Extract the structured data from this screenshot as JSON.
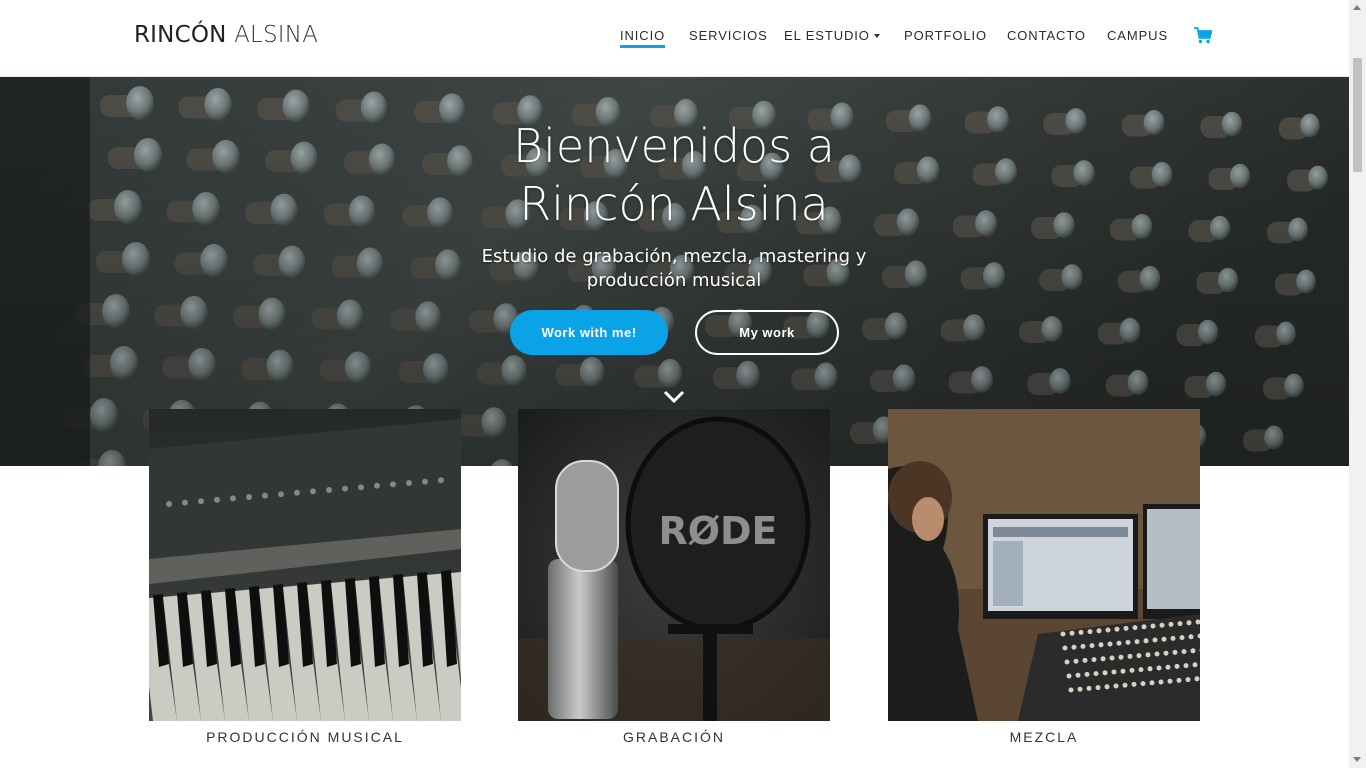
{
  "header": {
    "brand_bold": "RINCÓN",
    "brand_light": "ALSINA",
    "nav": [
      {
        "label": "INICIO",
        "active": true
      },
      {
        "label": "SERVICIOS"
      },
      {
        "label": "EL ESTUDIO",
        "has_dropdown": true
      },
      {
        "label": "PORTFOLIO"
      },
      {
        "label": "CONTACTO"
      },
      {
        "label": "CAMPUS"
      }
    ],
    "cart_icon": "shopping-cart-icon"
  },
  "hero": {
    "title": "Bienvenidos a Rincón Alsina",
    "subtitle": "Estudio de grabación, mezcla, mastering y producción musical",
    "primary_button": "Work with me!",
    "secondary_button": "My work",
    "scroll_icon": "chevron-down-icon"
  },
  "services": [
    {
      "title": "PRODUCCIÓN MUSICAL",
      "image": "synthesizer-keyboard-photo"
    },
    {
      "title": "GRABACIÓN",
      "image": "rode-microphone-photo",
      "brand_mark": "RØDE"
    },
    {
      "title": "MEZCLA",
      "image": "mixing-engineer-photo"
    }
  ],
  "colors": {
    "accent": "#0aa3e8",
    "text": "#222222",
    "background": "#ffffff"
  }
}
